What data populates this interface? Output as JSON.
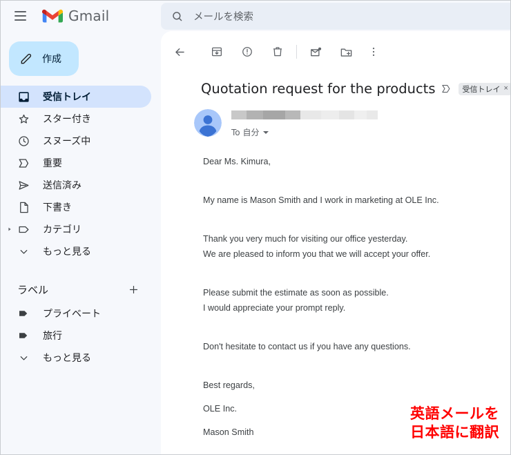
{
  "app": {
    "name": "Gmail"
  },
  "header": {
    "menu_icon": "hamburger-icon",
    "logo_icon": "gmail-logo-icon",
    "brand": "Gmail",
    "search": {
      "icon": "search-icon",
      "placeholder": "メールを検索",
      "value": ""
    }
  },
  "sidebar": {
    "compose": {
      "icon": "pencil-icon",
      "label": "作成"
    },
    "items": [
      {
        "icon": "inbox-icon",
        "label": "受信トレイ",
        "selected": true
      },
      {
        "icon": "star-icon",
        "label": "スター付き",
        "selected": false
      },
      {
        "icon": "clock-icon",
        "label": "スヌーズ中",
        "selected": false
      },
      {
        "icon": "important-icon",
        "label": "重要",
        "selected": false
      },
      {
        "icon": "send-icon",
        "label": "送信済み",
        "selected": false
      },
      {
        "icon": "draft-icon",
        "label": "下書き",
        "selected": false
      },
      {
        "icon": "label-icon",
        "label": "カテゴリ",
        "selected": false,
        "expandable": true
      },
      {
        "icon": "chevron-down-icon",
        "label": "もっと見る",
        "selected": false
      }
    ],
    "labels_section": {
      "title": "ラベル",
      "add_icon": "plus-icon",
      "items": [
        {
          "icon": "tag-icon",
          "label": "プライベート"
        },
        {
          "icon": "tag-icon",
          "label": "旅行"
        },
        {
          "icon": "chevron-down-icon",
          "label": "もっと見る"
        }
      ]
    }
  },
  "mail": {
    "toolbar": [
      {
        "name": "back-button",
        "icon": "arrow-left-icon"
      },
      {
        "name": "archive-button",
        "icon": "archive-icon"
      },
      {
        "name": "report-spam-button",
        "icon": "report-spam-icon"
      },
      {
        "name": "delete-button",
        "icon": "trash-icon"
      },
      {
        "name": "mark-unread-button",
        "icon": "mark-unread-icon"
      },
      {
        "name": "move-to-button",
        "icon": "move-to-folder-icon"
      },
      {
        "name": "more-options-button",
        "icon": "more-vertical-icon"
      }
    ],
    "subject": "Quotation request for the products",
    "important_icon": "important-marker-icon",
    "label_chip": {
      "text": "受信トレイ",
      "remove": "×"
    },
    "sender": {
      "avatar_icon": "avatar-icon",
      "name_redacted": true,
      "to_label": "To 自分",
      "expand_icon": "chevron-down-icon"
    },
    "body_paragraphs": [
      {
        "text": "Dear Ms. Kimura,",
        "spacing": "gap"
      },
      {
        "text": "My name is Mason Smith and I work in marketing at OLE Inc.",
        "spacing": "gap"
      },
      {
        "text": "Thank you very much for visiting our office yesterday.",
        "spacing": "tight"
      },
      {
        "text": "We are pleased to inform you that we will accept your offer.",
        "spacing": "gap"
      },
      {
        "text": "Please submit the estimate as soon as possible.",
        "spacing": "tight"
      },
      {
        "text": "I would appreciate your prompt reply.",
        "spacing": "gap"
      },
      {
        "text": "Don't hesitate to contact us if you have any questions.",
        "spacing": "gap"
      },
      {
        "text": "Best regards,",
        "spacing": "sig"
      },
      {
        "text": "OLE Inc.",
        "spacing": "sig"
      },
      {
        "text": "Mason Smith",
        "spacing": "sig"
      }
    ]
  },
  "annotation": {
    "line1": "英語メールを",
    "line2": "日本語に翻訳",
    "color": "#ff0000"
  },
  "colors": {
    "background": "#f6f8fc",
    "pane": "#ffffff",
    "compose_bg": "#c2e7ff",
    "selected_bg": "#d3e3fd",
    "search_bg": "#e9eef6",
    "chip_bg": "#e8eaed",
    "text_primary": "#202124",
    "text_secondary": "#5f6368",
    "avatar_blue": "#8ab4f8"
  }
}
